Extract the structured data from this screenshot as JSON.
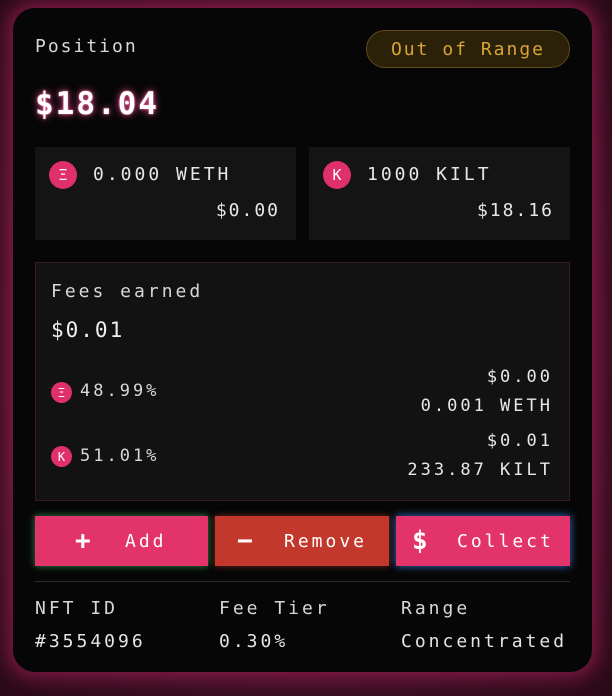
{
  "position": {
    "title": "Position",
    "status_badge": "Out of Range",
    "value": "$18.04"
  },
  "tokens": [
    {
      "icon": "weth-coin-icon",
      "symbol_glyph": "Ξ",
      "amount": "0.000 WETH",
      "usd": "$0.00"
    },
    {
      "icon": "kilt-coin-icon",
      "symbol_glyph": "K",
      "amount": "1000 KILT",
      "usd": "$18.16"
    }
  ],
  "fees": {
    "label": "Fees earned",
    "total": "$0.01",
    "rows": [
      {
        "symbol_glyph": "Ξ",
        "percent": "48.99%",
        "usd": "$0.00",
        "amount": "0.001 WETH"
      },
      {
        "symbol_glyph": "K",
        "percent": "51.01%",
        "usd": "$0.01",
        "amount": "233.87 KILT"
      }
    ]
  },
  "actions": {
    "add": {
      "icon": "plus-icon",
      "glyph": "+",
      "label": "Add"
    },
    "remove": {
      "icon": "minus-icon",
      "glyph": "−",
      "label": "Remove"
    },
    "collect": {
      "icon": "dollar-icon",
      "glyph": "$",
      "label": "Collect"
    }
  },
  "details": [
    {
      "label": "NFT ID",
      "value": "#3554096"
    },
    {
      "label": "Fee Tier",
      "value": "0.30%"
    },
    {
      "label": "Range",
      "value": "Concentrated"
    }
  ],
  "colors": {
    "accent_pink": "#e2336a",
    "remove_red": "#c3382c",
    "badge_gold": "#d9a436"
  }
}
